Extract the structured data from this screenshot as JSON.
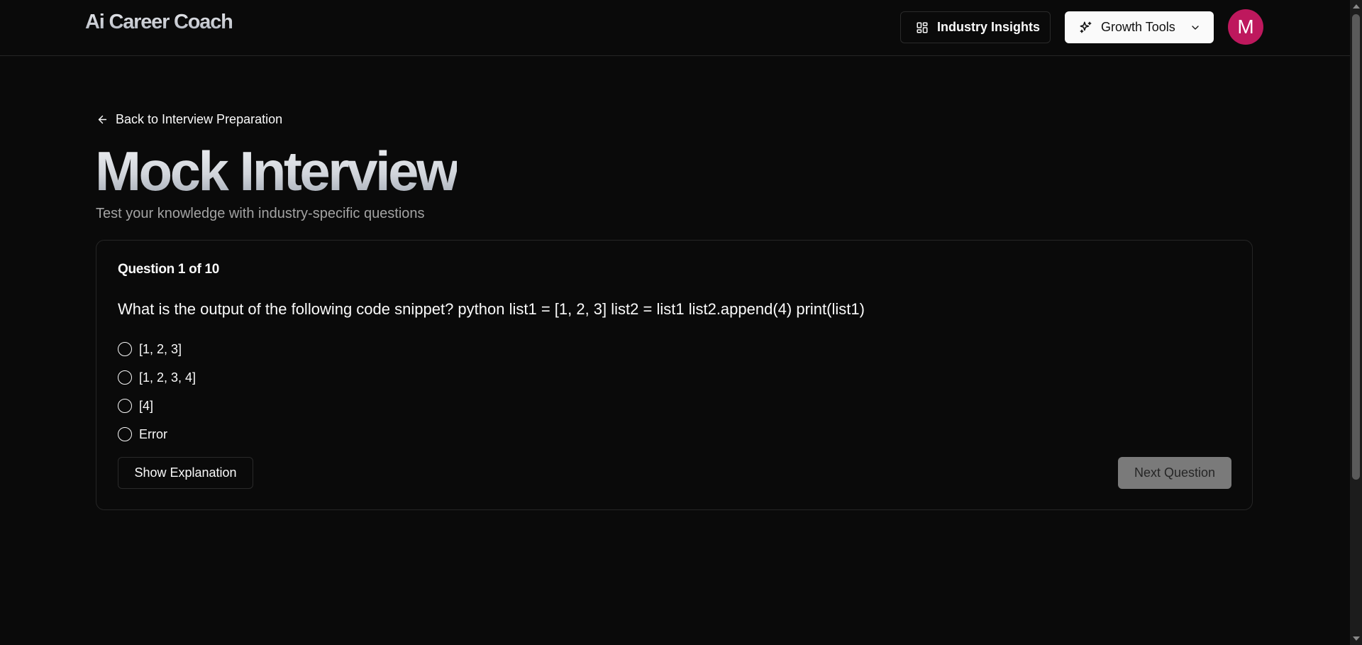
{
  "header": {
    "logo": "Ai Career Coach",
    "insights_label": "Industry Insights",
    "insights_icon": "layout-dashboard-icon",
    "growth_label": "Growth Tools",
    "growth_icon": "sparkles-icon",
    "avatar_initial": "M"
  },
  "nav": {
    "back_label": "Back to Interview Preparation"
  },
  "page": {
    "title": "Mock Interview",
    "subtitle": "Test your knowledge with industry-specific questions"
  },
  "quiz": {
    "counter": "Question 1 of 10",
    "question": "What is the output of the following code snippet? python list1 = [1, 2, 3] list2 = list1 list2.append(4) print(list1)",
    "options": [
      "[1, 2, 3]",
      "[1, 2, 3, 4]",
      "[4]",
      "Error"
    ],
    "explain_label": "Show Explanation",
    "next_label": "Next Question"
  },
  "colors": {
    "background": "#0a0a0a",
    "avatar": "#be185d",
    "next_button_disabled": "#7a7a7a"
  }
}
